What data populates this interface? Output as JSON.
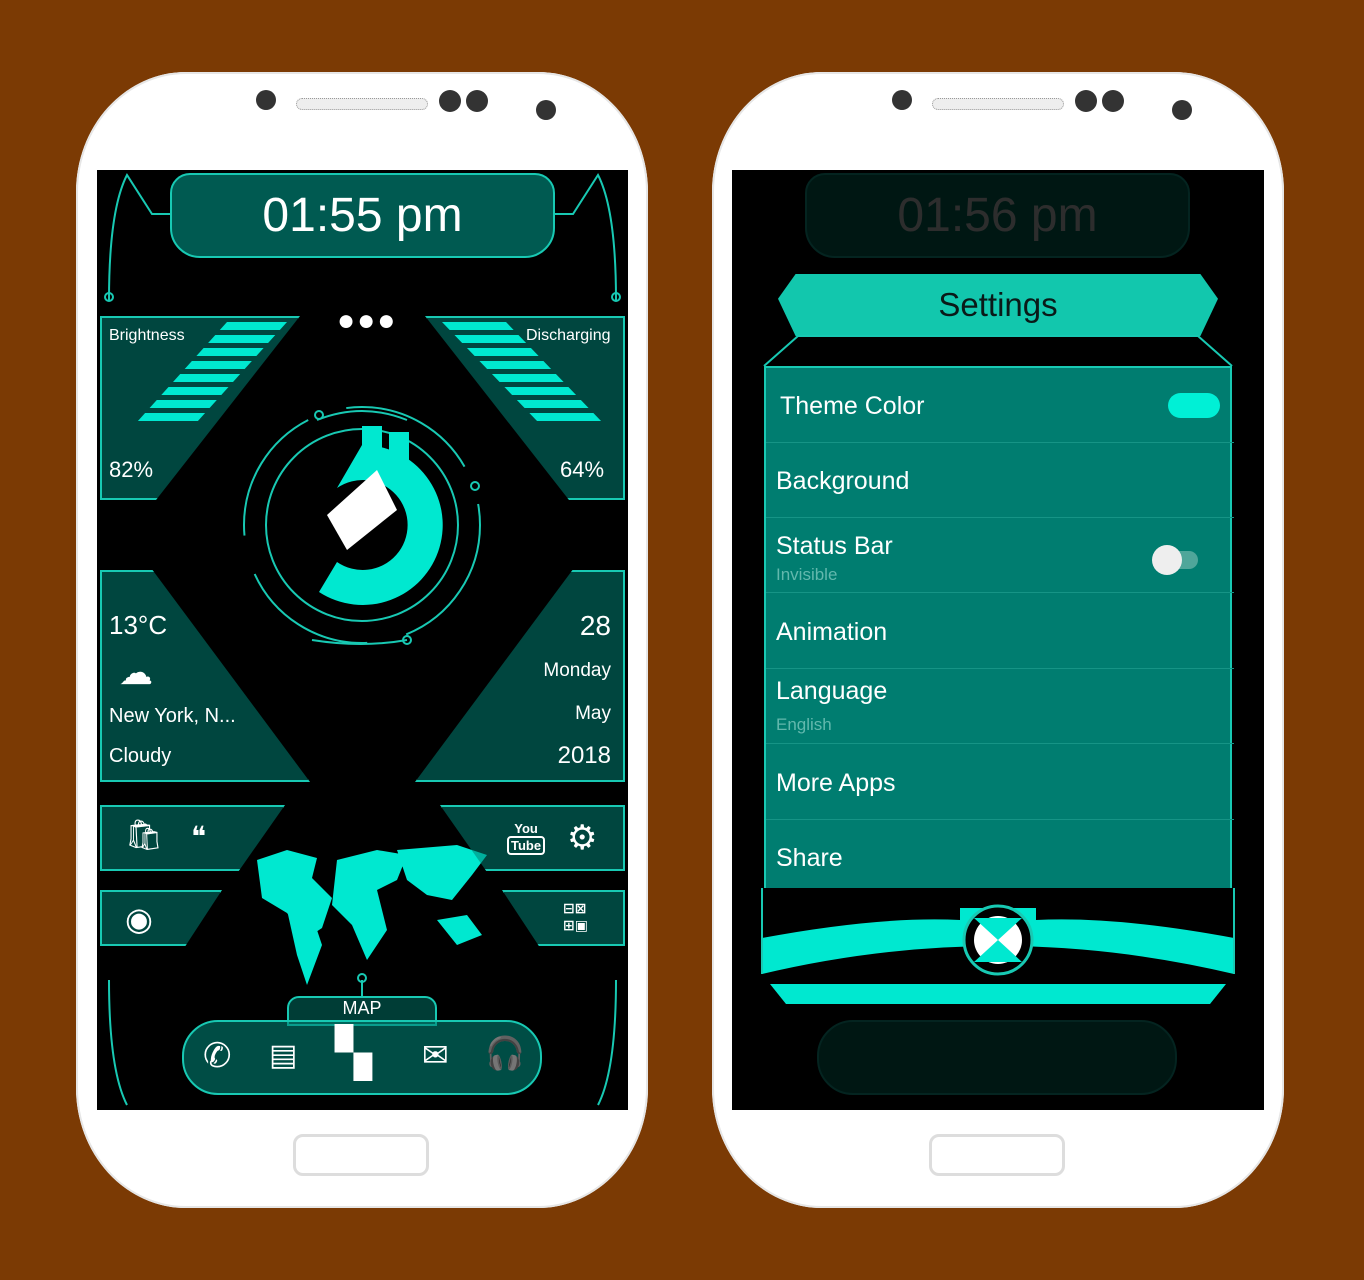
{
  "colors": {
    "background": "#7b3a04",
    "accent": "#00f5dc",
    "panel": "#007d70",
    "screen": "#000000"
  },
  "left_phone": {
    "clock": "01:55 pm",
    "menu_icon": "more-dots-icon",
    "brightness": {
      "label": "Brightness",
      "value": "82%",
      "level": 0.82
    },
    "battery": {
      "label": "Discharging",
      "value": "64%",
      "level": 0.64
    },
    "weather": {
      "temp": "13°C",
      "icon": "cloud-icon",
      "location": "New York, N...",
      "condition": "Cloudy"
    },
    "date": {
      "day": "28",
      "weekday": "Monday",
      "month": "May",
      "year": "2018"
    },
    "apps": [
      {
        "icon": "play-store-icon"
      },
      {
        "icon": "hangouts-icon"
      },
      {
        "icon": "youtube-icon",
        "label_top": "You",
        "label_bottom": "Tube"
      },
      {
        "icon": "settings-gear-icon"
      },
      {
        "icon": "chrome-icon"
      },
      {
        "icon": "calculator-icon"
      }
    ],
    "map_label": "MAP",
    "dock": [
      {
        "icon": "phone-icon"
      },
      {
        "icon": "message-icon"
      },
      {
        "icon": "apps-grid-icon"
      },
      {
        "icon": "mail-icon"
      },
      {
        "icon": "headset-icon"
      }
    ]
  },
  "right_phone": {
    "background_clock": "01:56 pm",
    "settings": {
      "title": "Settings",
      "items": [
        {
          "label": "Theme Color",
          "control": "color-swatch"
        },
        {
          "label": "Background"
        },
        {
          "label": "Status Bar",
          "sub": "Invisible",
          "control": "toggle",
          "on": false
        },
        {
          "label": "Animation"
        },
        {
          "label": "Language",
          "sub": "English"
        },
        {
          "label": "More Apps"
        },
        {
          "label": "Share"
        }
      ]
    }
  }
}
